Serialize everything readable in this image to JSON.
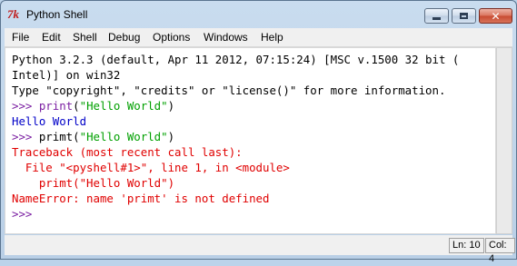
{
  "window": {
    "title": "Python Shell",
    "icon": "tk-feather-icon"
  },
  "controls": {
    "close_glyph": "✕"
  },
  "menu": [
    "File",
    "Edit",
    "Shell",
    "Debug",
    "Options",
    "Windows",
    "Help"
  ],
  "shell": {
    "lines": [
      {
        "segments": [
          {
            "text": "Python 3.2.3 (default, Apr 11 2012, 07:15:24) [MSC v.1500 32 bit (",
            "color": "black"
          }
        ]
      },
      {
        "segments": [
          {
            "text": "Intel)] on win32",
            "color": "black"
          }
        ]
      },
      {
        "segments": [
          {
            "text": "Type \"copyright\", \"credits\" or \"license()\" for more information.",
            "color": "black"
          }
        ]
      },
      {
        "segments": [
          {
            "text": ">>> ",
            "color": "purple"
          },
          {
            "text": "print",
            "color": "purple"
          },
          {
            "text": "(",
            "color": "black"
          },
          {
            "text": "\"Hello World\"",
            "color": "green"
          },
          {
            "text": ")",
            "color": "black"
          }
        ]
      },
      {
        "segments": [
          {
            "text": "Hello World",
            "color": "blue"
          }
        ]
      },
      {
        "segments": [
          {
            "text": ">>> ",
            "color": "purple"
          },
          {
            "text": "primt(",
            "color": "black"
          },
          {
            "text": "\"Hello World\"",
            "color": "green"
          },
          {
            "text": ")",
            "color": "black"
          }
        ]
      },
      {
        "segments": [
          {
            "text": "Traceback (most recent call last):",
            "color": "red"
          }
        ]
      },
      {
        "segments": [
          {
            "text": "  File \"<pyshell#1>\", line 1, in <module>",
            "color": "red"
          }
        ]
      },
      {
        "segments": [
          {
            "text": "    primt(\"Hello World\")",
            "color": "red"
          }
        ]
      },
      {
        "segments": [
          {
            "text": "NameError: name 'primt' is not defined",
            "color": "red"
          }
        ]
      },
      {
        "segments": [
          {
            "text": ">>> ",
            "color": "purple"
          }
        ]
      }
    ]
  },
  "status": {
    "line": "Ln: 10",
    "col": "Col: 4"
  }
}
